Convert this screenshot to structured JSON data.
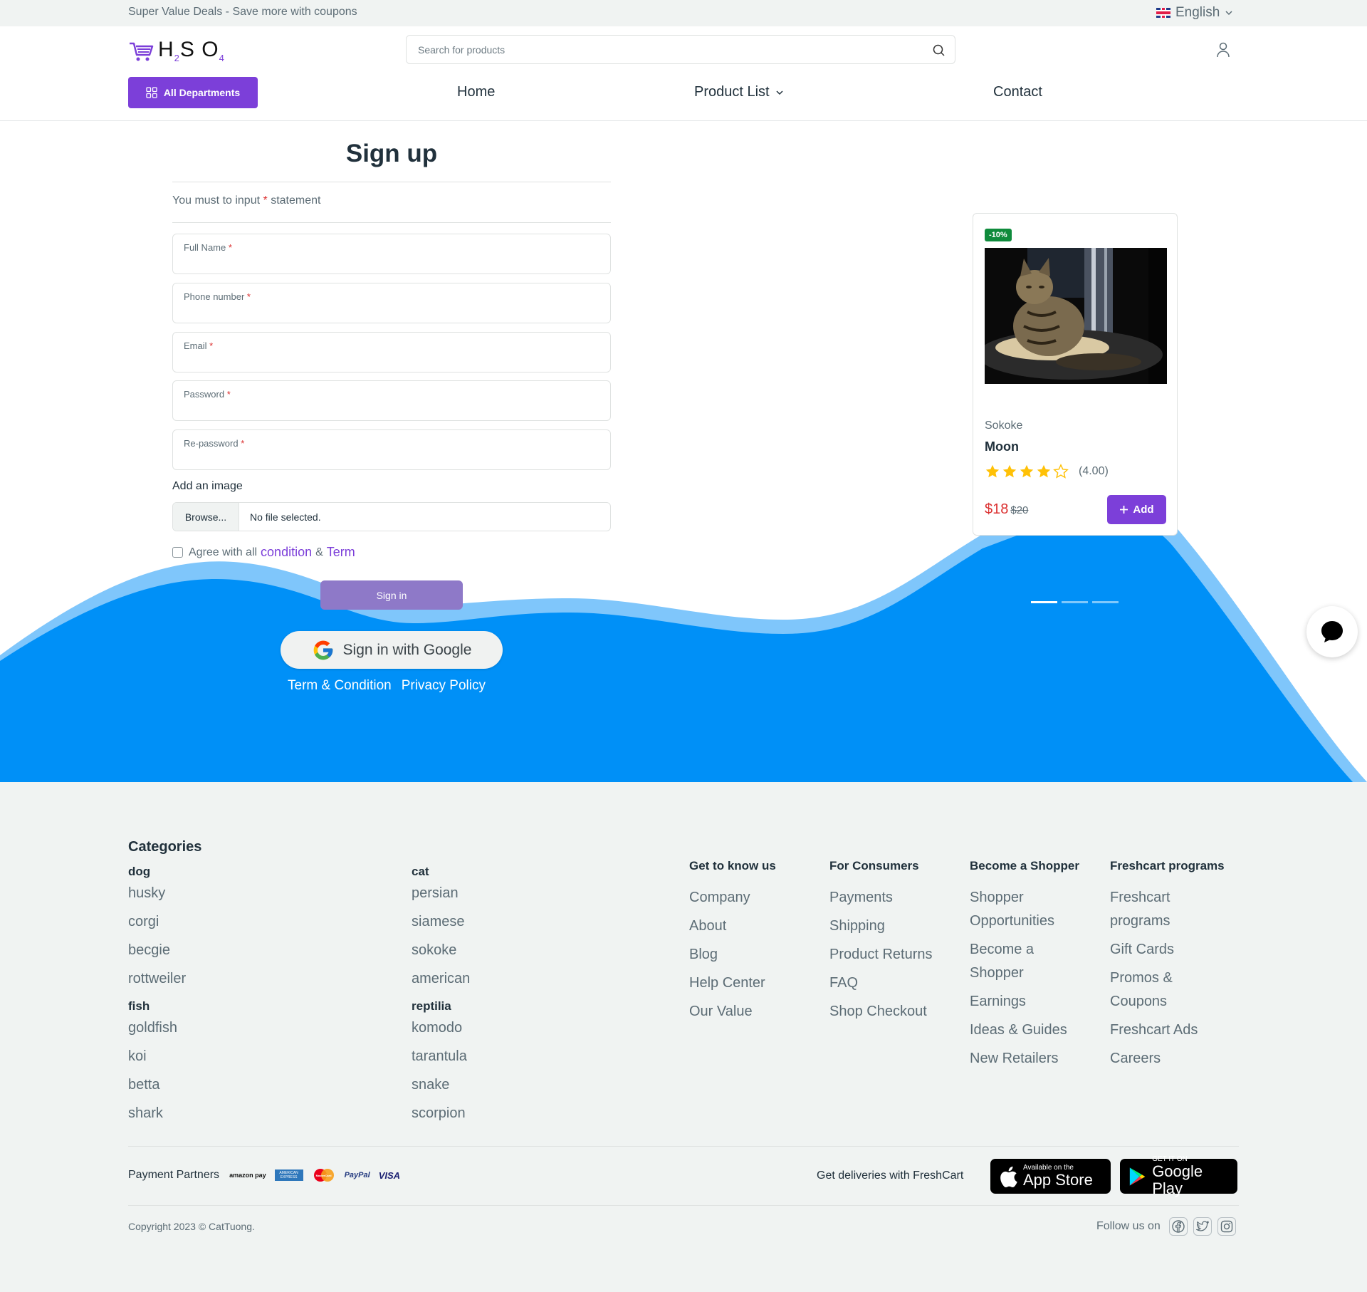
{
  "topbar": {
    "promo": "Super Value Deals - Save more with coupons",
    "language": "English",
    "flag_icon": "uk-flag-icon"
  },
  "header": {
    "logo": {
      "h": "H",
      "h_sub": "2",
      "s": "S",
      "o": "O",
      "o_sub": "4",
      "icon": "cart-icon"
    },
    "search_placeholder": "Search for products",
    "all_departments": "All Departments",
    "nav": {
      "home": "Home",
      "product_list": "Product List",
      "contact": "Contact"
    }
  },
  "form": {
    "title": "Sign up",
    "note_prefix": "You must to input",
    "note_star": "*",
    "note_suffix": "statement",
    "fields": [
      {
        "label": "Full Name",
        "star": "*"
      },
      {
        "label": "Phone number",
        "star": "*"
      },
      {
        "label": "Email",
        "star": "*"
      },
      {
        "label": "Password",
        "star": "*"
      },
      {
        "label": "Re-password",
        "star": "*"
      }
    ],
    "add_image": "Add an image",
    "browse": "Browse...",
    "no_file": "No file selected.",
    "agree_prefix": "Agree with all",
    "condition": "condition",
    "amp": "&",
    "term": "Term",
    "signin": "Sign in",
    "google": "Sign in with Google",
    "term_condition": "Term & Condition",
    "privacy": "Privacy Policy"
  },
  "product": {
    "badge": "-10%",
    "category": "Sokoke",
    "name": "Moon",
    "rating_value": 4.0,
    "rating_text": "(4.00)",
    "price": "$18",
    "old_price": "$20",
    "add": "Add",
    "carousel_active": 1,
    "carousel_count": 3
  },
  "footer": {
    "categories_title": "Categories",
    "groups": [
      {
        "name": "dog",
        "items": [
          "husky",
          "corgi",
          "becgie",
          "rottweiler"
        ]
      },
      {
        "name": "cat",
        "items": [
          "persian",
          "siamese",
          "sokoke",
          "american"
        ]
      },
      {
        "name": "fish",
        "items": [
          "goldfish",
          "koi",
          "betta",
          "shark"
        ]
      },
      {
        "name": "reptilia",
        "items": [
          "komodo",
          "tarantula",
          "snake",
          "scorpion"
        ]
      }
    ],
    "columns": [
      {
        "title": "Get to know us",
        "items": [
          "Company",
          "About",
          "Blog",
          "Help Center",
          "Our Value"
        ]
      },
      {
        "title": "For Consumers",
        "items": [
          "Payments",
          "Shipping",
          "Product Returns",
          "FAQ",
          "Shop Checkout"
        ]
      },
      {
        "title": "Become a Shopper",
        "items": [
          "Shopper Opportunities",
          "Become a Shopper",
          "Earnings",
          "Ideas & Guides",
          "New Retailers"
        ]
      },
      {
        "title": "Freshcart programs",
        "items": [
          "Freshcart programs",
          "Gift Cards",
          "Promos & Coupons",
          "Freshcart Ads",
          "Careers"
        ]
      }
    ],
    "payment_label": "Payment Partners",
    "payments": {
      "amazon": "amazon pay",
      "amex": "AMERICAN EXPRESS",
      "mastercard": "MasterCard",
      "paypal": "PayPal",
      "visa": "VISA"
    },
    "deliveries": "Get deliveries with FreshCart",
    "appstore": {
      "small": "Available on the",
      "big": "App Store"
    },
    "googleplay": {
      "small": "GET IT ON",
      "big": "Google Play"
    },
    "copyright": "Copyright 2023 © CatTuong.",
    "follow": "Follow us on"
  },
  "colors": {
    "brand": "#7c3fd9",
    "wave": "#0090f7",
    "wave_light": "#7fc6fb",
    "danger": "#db3030",
    "success": "#0f8b3c"
  }
}
